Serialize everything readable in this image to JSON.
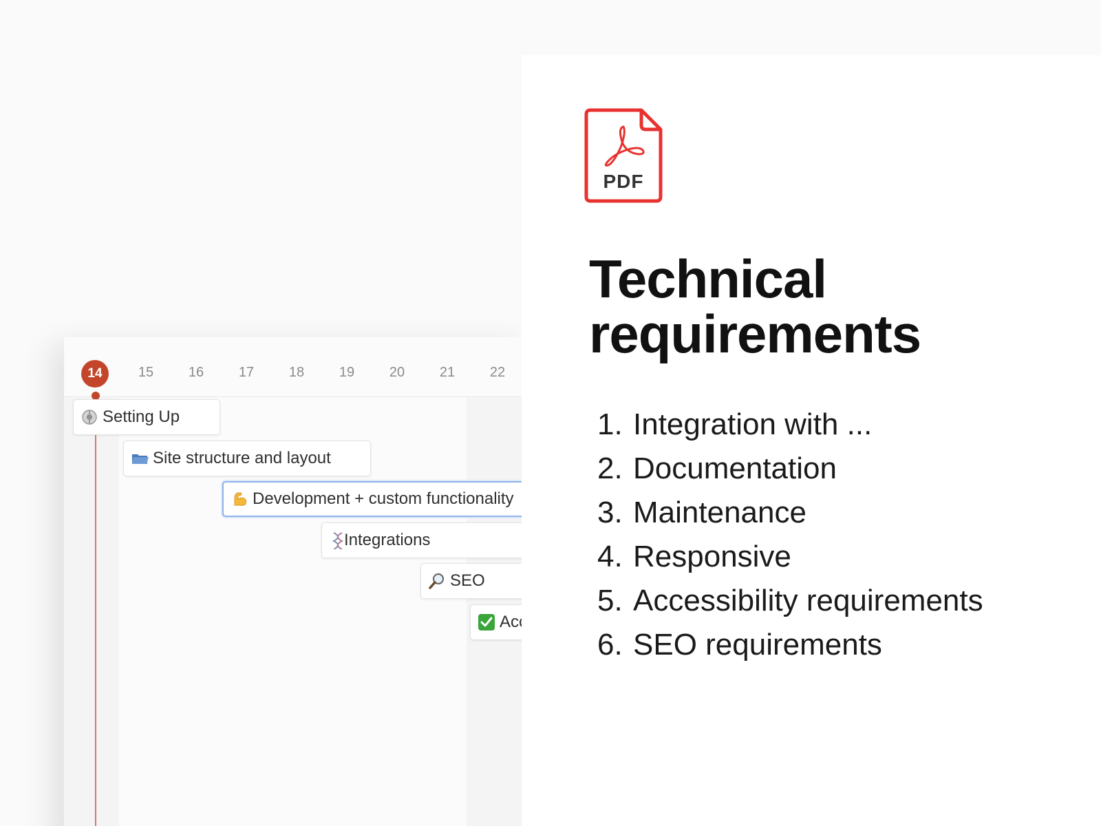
{
  "timeline": {
    "today": "14",
    "days": [
      "15",
      "16",
      "17",
      "18",
      "19",
      "20",
      "21",
      "22"
    ],
    "tasks": [
      {
        "icon": "gear-icon",
        "label": "Setting Up"
      },
      {
        "icon": "folder-icon",
        "label": "Site structure and layout"
      },
      {
        "icon": "flexed-biceps-icon",
        "label": "Development + custom functionality"
      },
      {
        "icon": "dna-icon",
        "label": "Integrations"
      },
      {
        "icon": "magnifier-icon",
        "label": "SEO"
      },
      {
        "icon": "check-mark-icon",
        "label": "Accessibility"
      }
    ]
  },
  "document": {
    "file_icon": "pdf-file-icon",
    "file_icon_label": "PDF",
    "title_line1": "Technical",
    "title_line2": "requirements",
    "items": [
      {
        "num": "1.",
        "text": "Integration with ..."
      },
      {
        "num": "2.",
        "text": "Documentation"
      },
      {
        "num": "3.",
        "text": "Maintenance"
      },
      {
        "num": "4.",
        "text": "Responsive"
      },
      {
        "num": "5.",
        "text": "Accessibility requirements"
      },
      {
        "num": "6.",
        "text": "SEO requirements"
      }
    ]
  },
  "colors": {
    "today_badge": "#c3462b",
    "pdf_red": "#e8322f",
    "selected_border": "#8fb3ea"
  }
}
